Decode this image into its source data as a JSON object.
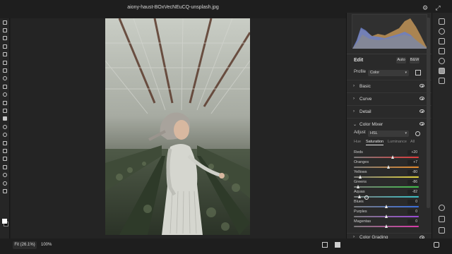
{
  "document": {
    "title": "aiony-haust-BOxVecNEuCQ-unsplash.jpg"
  },
  "status": {
    "fit_label": "Fit (26.1%)",
    "zoom_label": "100%"
  },
  "panel": {
    "edit_title": "Edit",
    "auto_label": "Auto",
    "bw_label": "B&W",
    "profile_label": "Profile",
    "profile_value": "Color",
    "sections": {
      "basic": "Basic",
      "curve": "Curve",
      "detail": "Detail",
      "color_mixer": "Color Mixer",
      "color_grading": "Color Grading"
    },
    "adjust_label": "Adjust",
    "adjust_value": "HSL",
    "tabs": {
      "hue": "Hue",
      "saturation": "Saturation",
      "luminance": "Luminance",
      "all": "All"
    },
    "sliders": [
      {
        "label": "Reds",
        "value": "+20",
        "percent": 60
      },
      {
        "label": "Oranges",
        "value": "+7",
        "percent": 53.5
      },
      {
        "label": "Yellows",
        "value": "-80",
        "percent": 10
      },
      {
        "label": "Greens",
        "value": "-86",
        "percent": 7
      },
      {
        "label": "Aquas",
        "value": "-82",
        "percent": 9
      },
      {
        "label": "Blues",
        "value": "0",
        "percent": 50
      },
      {
        "label": "Purples",
        "value": "0",
        "percent": 50
      },
      {
        "label": "Magentas",
        "value": "0",
        "percent": 50
      }
    ]
  },
  "colors": {
    "app_bg": "#1e1e1e",
    "panel_bg": "#2a2a2a",
    "foreground_swatch": "#ffffff",
    "background_swatch": "#111111",
    "histogram_blue": "#6a7fc8",
    "histogram_orange": "#c99a5a"
  }
}
